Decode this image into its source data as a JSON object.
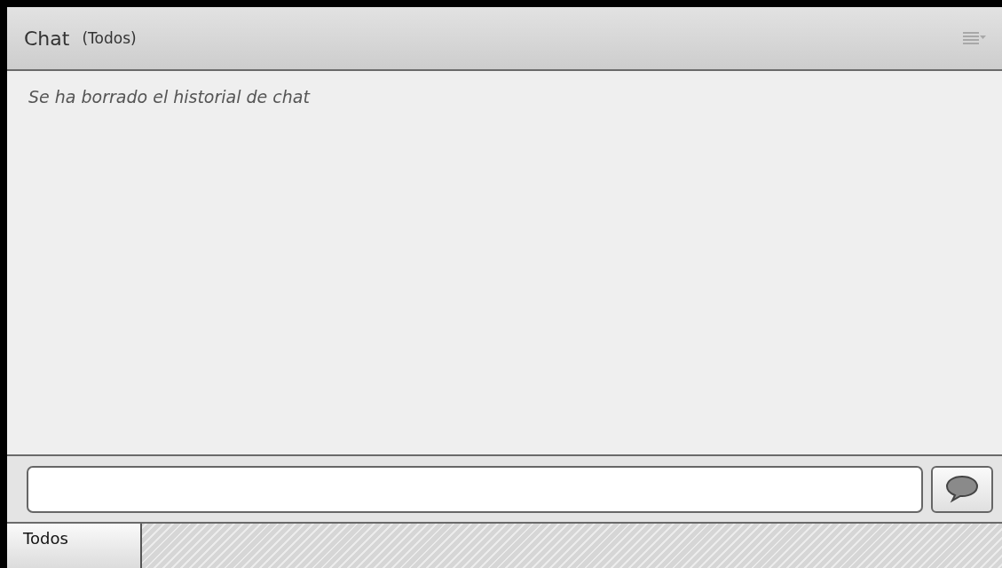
{
  "header": {
    "title": "Chat",
    "audience": "(Todos)"
  },
  "messages": [
    {
      "kind": "system",
      "text": "Se ha borrado el historial de chat"
    }
  ],
  "tabs": [
    {
      "label": "Todos",
      "selected": true
    }
  ]
}
